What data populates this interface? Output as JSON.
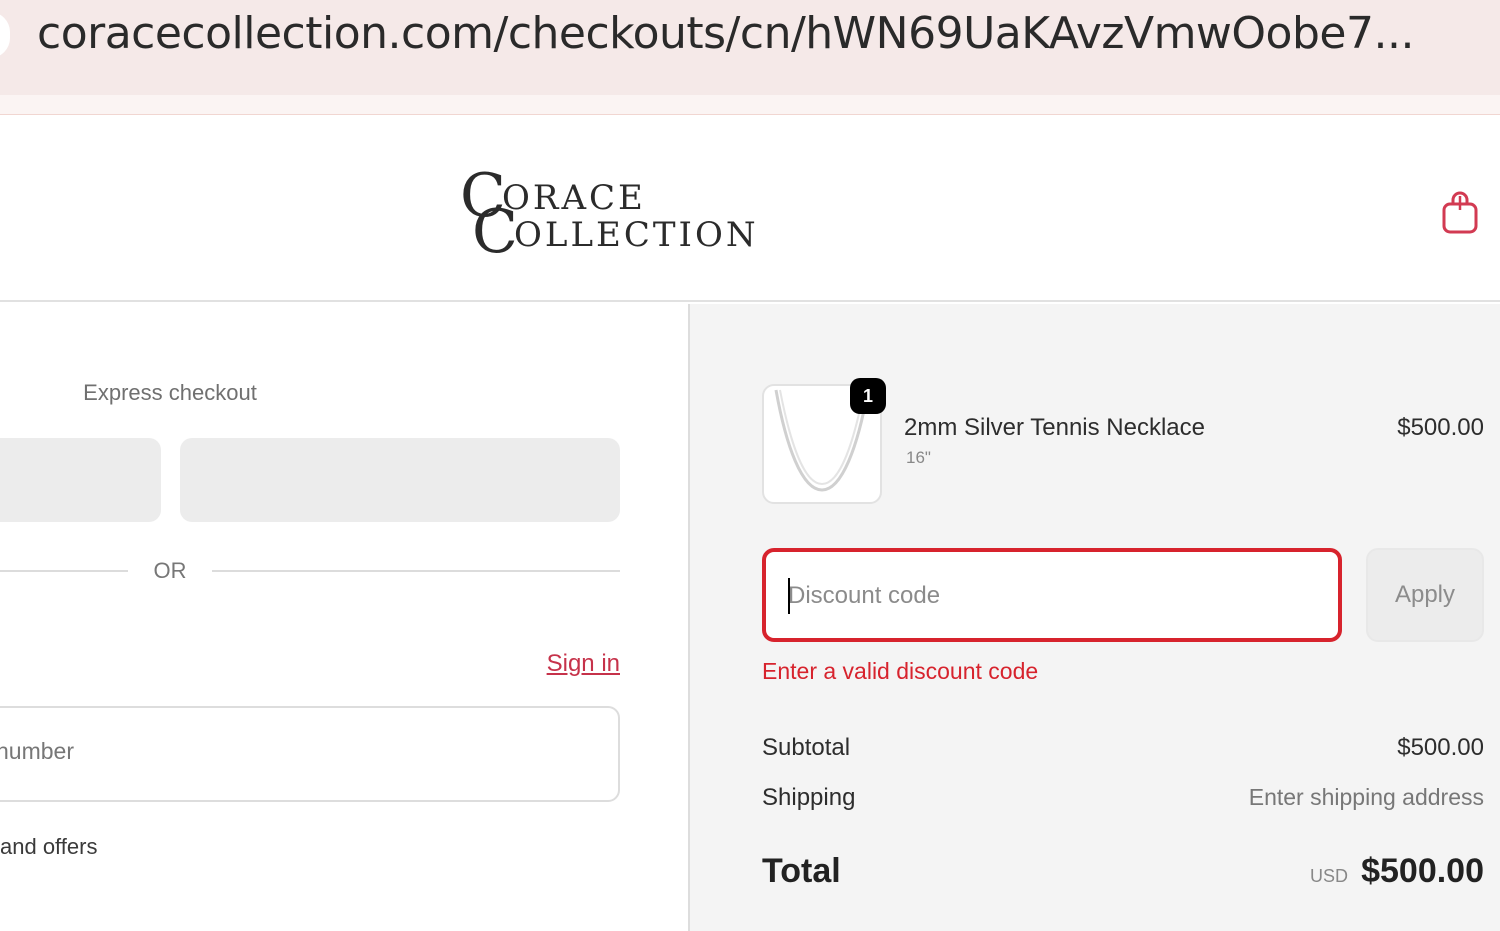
{
  "browser": {
    "url": "coracecollection.com/checkouts/cn/hWN69UaKAvzVmwOobe7..."
  },
  "header": {
    "logo_line1": "ORACE",
    "logo_line2": "OLLECTION",
    "logo_initial": "C",
    "cart_icon": "shopping-bag-icon"
  },
  "checkout": {
    "express_label": "Express checkout",
    "or_label": "OR",
    "signin_label": "Sign in",
    "contact_placeholder": "number",
    "offers_text": "and offers"
  },
  "summary": {
    "product": {
      "name": "2mm Silver Tennis Necklace",
      "variant": "16\"",
      "price": "$500.00",
      "quantity": "1"
    },
    "discount": {
      "placeholder": "Discount code",
      "apply_label": "Apply",
      "error": "Enter a valid discount code"
    },
    "subtotal_label": "Subtotal",
    "subtotal_value": "$500.00",
    "shipping_label": "Shipping",
    "shipping_value": "Enter shipping address",
    "total_label": "Total",
    "total_currency": "USD",
    "total_value": "$500.00"
  },
  "colors": {
    "accent": "#c6324a",
    "error": "#d7232d",
    "urlbar_bg": "#f5e9e8",
    "summary_bg": "#f4f4f4"
  }
}
